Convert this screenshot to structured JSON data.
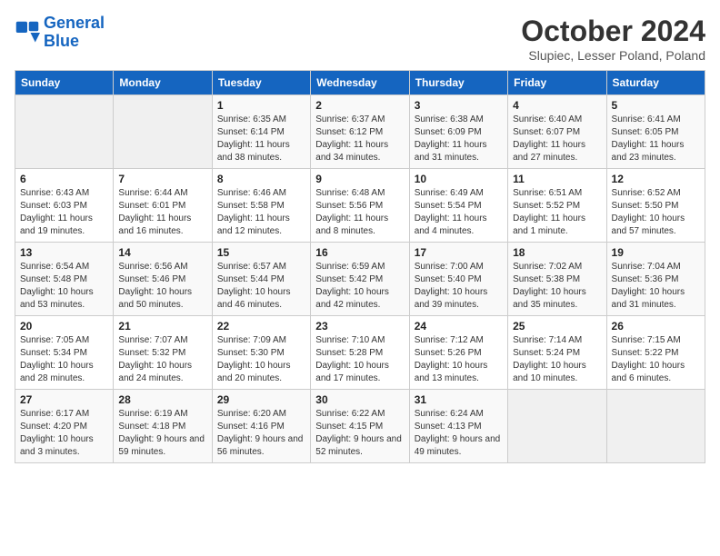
{
  "header": {
    "logo_line1": "General",
    "logo_line2": "Blue",
    "title": "October 2024",
    "subtitle": "Slupiec, Lesser Poland, Poland"
  },
  "days_of_week": [
    "Sunday",
    "Monday",
    "Tuesday",
    "Wednesday",
    "Thursday",
    "Friday",
    "Saturday"
  ],
  "weeks": [
    [
      {
        "day": "",
        "detail": ""
      },
      {
        "day": "",
        "detail": ""
      },
      {
        "day": "1",
        "detail": "Sunrise: 6:35 AM\nSunset: 6:14 PM\nDaylight: 11 hours and 38 minutes."
      },
      {
        "day": "2",
        "detail": "Sunrise: 6:37 AM\nSunset: 6:12 PM\nDaylight: 11 hours and 34 minutes."
      },
      {
        "day": "3",
        "detail": "Sunrise: 6:38 AM\nSunset: 6:09 PM\nDaylight: 11 hours and 31 minutes."
      },
      {
        "day": "4",
        "detail": "Sunrise: 6:40 AM\nSunset: 6:07 PM\nDaylight: 11 hours and 27 minutes."
      },
      {
        "day": "5",
        "detail": "Sunrise: 6:41 AM\nSunset: 6:05 PM\nDaylight: 11 hours and 23 minutes."
      }
    ],
    [
      {
        "day": "6",
        "detail": "Sunrise: 6:43 AM\nSunset: 6:03 PM\nDaylight: 11 hours and 19 minutes."
      },
      {
        "day": "7",
        "detail": "Sunrise: 6:44 AM\nSunset: 6:01 PM\nDaylight: 11 hours and 16 minutes."
      },
      {
        "day": "8",
        "detail": "Sunrise: 6:46 AM\nSunset: 5:58 PM\nDaylight: 11 hours and 12 minutes."
      },
      {
        "day": "9",
        "detail": "Sunrise: 6:48 AM\nSunset: 5:56 PM\nDaylight: 11 hours and 8 minutes."
      },
      {
        "day": "10",
        "detail": "Sunrise: 6:49 AM\nSunset: 5:54 PM\nDaylight: 11 hours and 4 minutes."
      },
      {
        "day": "11",
        "detail": "Sunrise: 6:51 AM\nSunset: 5:52 PM\nDaylight: 11 hours and 1 minute."
      },
      {
        "day": "12",
        "detail": "Sunrise: 6:52 AM\nSunset: 5:50 PM\nDaylight: 10 hours and 57 minutes."
      }
    ],
    [
      {
        "day": "13",
        "detail": "Sunrise: 6:54 AM\nSunset: 5:48 PM\nDaylight: 10 hours and 53 minutes."
      },
      {
        "day": "14",
        "detail": "Sunrise: 6:56 AM\nSunset: 5:46 PM\nDaylight: 10 hours and 50 minutes."
      },
      {
        "day": "15",
        "detail": "Sunrise: 6:57 AM\nSunset: 5:44 PM\nDaylight: 10 hours and 46 minutes."
      },
      {
        "day": "16",
        "detail": "Sunrise: 6:59 AM\nSunset: 5:42 PM\nDaylight: 10 hours and 42 minutes."
      },
      {
        "day": "17",
        "detail": "Sunrise: 7:00 AM\nSunset: 5:40 PM\nDaylight: 10 hours and 39 minutes."
      },
      {
        "day": "18",
        "detail": "Sunrise: 7:02 AM\nSunset: 5:38 PM\nDaylight: 10 hours and 35 minutes."
      },
      {
        "day": "19",
        "detail": "Sunrise: 7:04 AM\nSunset: 5:36 PM\nDaylight: 10 hours and 31 minutes."
      }
    ],
    [
      {
        "day": "20",
        "detail": "Sunrise: 7:05 AM\nSunset: 5:34 PM\nDaylight: 10 hours and 28 minutes."
      },
      {
        "day": "21",
        "detail": "Sunrise: 7:07 AM\nSunset: 5:32 PM\nDaylight: 10 hours and 24 minutes."
      },
      {
        "day": "22",
        "detail": "Sunrise: 7:09 AM\nSunset: 5:30 PM\nDaylight: 10 hours and 20 minutes."
      },
      {
        "day": "23",
        "detail": "Sunrise: 7:10 AM\nSunset: 5:28 PM\nDaylight: 10 hours and 17 minutes."
      },
      {
        "day": "24",
        "detail": "Sunrise: 7:12 AM\nSunset: 5:26 PM\nDaylight: 10 hours and 13 minutes."
      },
      {
        "day": "25",
        "detail": "Sunrise: 7:14 AM\nSunset: 5:24 PM\nDaylight: 10 hours and 10 minutes."
      },
      {
        "day": "26",
        "detail": "Sunrise: 7:15 AM\nSunset: 5:22 PM\nDaylight: 10 hours and 6 minutes."
      }
    ],
    [
      {
        "day": "27",
        "detail": "Sunrise: 6:17 AM\nSunset: 4:20 PM\nDaylight: 10 hours and 3 minutes."
      },
      {
        "day": "28",
        "detail": "Sunrise: 6:19 AM\nSunset: 4:18 PM\nDaylight: 9 hours and 59 minutes."
      },
      {
        "day": "29",
        "detail": "Sunrise: 6:20 AM\nSunset: 4:16 PM\nDaylight: 9 hours and 56 minutes."
      },
      {
        "day": "30",
        "detail": "Sunrise: 6:22 AM\nSunset: 4:15 PM\nDaylight: 9 hours and 52 minutes."
      },
      {
        "day": "31",
        "detail": "Sunrise: 6:24 AM\nSunset: 4:13 PM\nDaylight: 9 hours and 49 minutes."
      },
      {
        "day": "",
        "detail": ""
      },
      {
        "day": "",
        "detail": ""
      }
    ]
  ]
}
